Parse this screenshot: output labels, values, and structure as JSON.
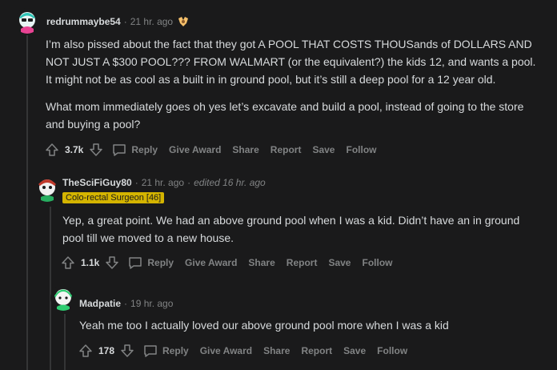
{
  "comments": [
    {
      "author": "redrummaybe54",
      "time": "21 hr. ago",
      "paragraphs": [
        "I’m also pissed about the fact that they got A POOL THAT COSTS THOUSands of DOLLARS AND NOT JUST A $300 POOL??? FROM WALMART (or the equivalent?) the kids 12, and wants a pool. It might not be as cool as a built in in ground pool, but it’s still a deep pool for a 12 year old.",
        "What mom immediately goes oh yes let’s excavate and build a pool, instead of going to the store and buying a pool?"
      ],
      "score": "3.7k",
      "avatar_color": "#2ec4b6"
    },
    {
      "author": "TheSciFiGuy80",
      "time": "21 hr. ago",
      "edited": "edited 16 hr. ago",
      "flair": "Colo-rectal Surgeon [46]",
      "paragraphs": [
        "Yep, a great point. We had an above ground pool when I was a kid. Didn’t have an in ground pool till we moved to a new house."
      ],
      "score": "1.1k",
      "avatar_color": "#e8e8e8"
    },
    {
      "author": "Madpatie",
      "time": "19 hr. ago",
      "paragraphs": [
        "Yeah me too I actually loved our above ground pool more when I was a kid"
      ],
      "score": "178",
      "avatar_color": "#2ecc71"
    }
  ],
  "actions": {
    "reply": "Reply",
    "give_award": "Give Award",
    "share": "Share",
    "report": "Report",
    "save": "Save",
    "follow": "Follow"
  },
  "icons": [
    "upvote-icon",
    "downvote-icon",
    "reply-icon",
    "award-icon"
  ]
}
